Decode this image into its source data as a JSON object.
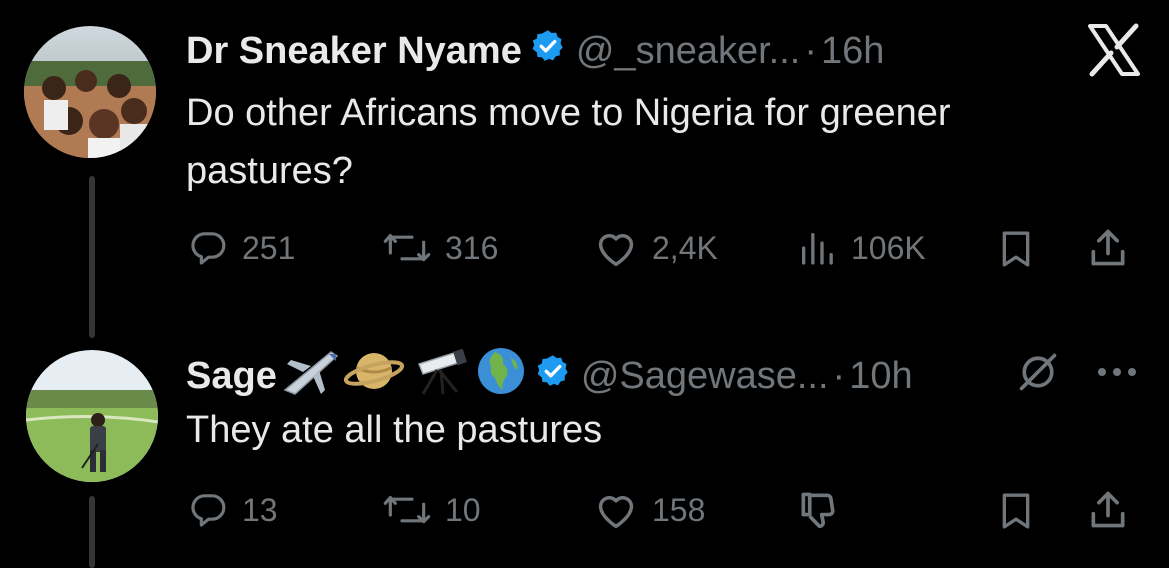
{
  "tweet1": {
    "display_name": "Dr Sneaker Nyame",
    "handle": "@_sneaker...",
    "separator": "·",
    "time": "16h",
    "text_line1": "Do other Africans move to Nigeria for greener",
    "text_line2": "pastures?",
    "replies": "251",
    "reposts": "316",
    "likes": "2,4K",
    "views": "106K"
  },
  "reply1": {
    "display_name": "Sage",
    "handle": "@Sagewase...",
    "separator": "·",
    "time": "10h",
    "text": "They ate all the pastures",
    "replies": "13",
    "reposts": "10",
    "likes": "158"
  },
  "colors": {
    "background": "#000000",
    "text": "#e7e9ea",
    "muted": "#71767b",
    "verified": "#1d9bf0",
    "thread_line": "#333639"
  },
  "icons": [
    "x-logo-icon",
    "verified-badge-icon",
    "reply-icon",
    "repost-icon",
    "like-icon",
    "views-icon",
    "bookmark-icon",
    "share-icon",
    "grok-icon",
    "more-icon",
    "dislike-icon",
    "airplane-icon",
    "ringed-planet-icon",
    "telescope-icon",
    "globe-icon"
  ]
}
